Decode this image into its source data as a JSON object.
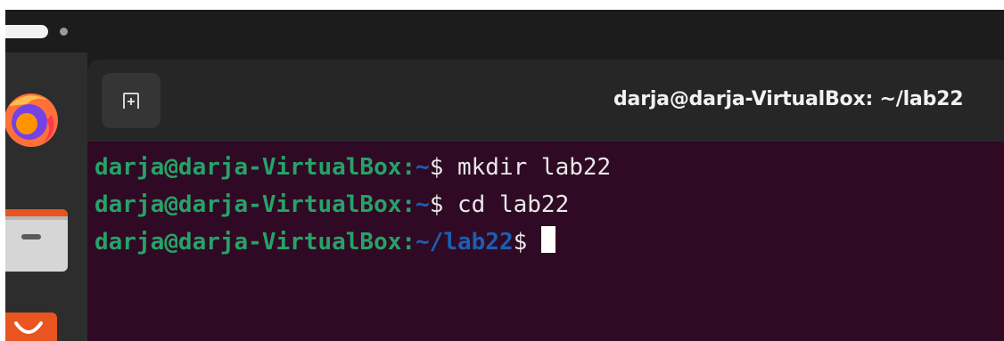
{
  "topbar": {
    "workspace_indicator": "active-workspace-pill"
  },
  "dock": {
    "apps": [
      {
        "name": "Firefox",
        "icon": "firefox-icon"
      },
      {
        "name": "Files",
        "icon": "files-icon"
      },
      {
        "name": "Ubuntu Software",
        "icon": "software-store-icon"
      }
    ]
  },
  "window": {
    "title": "darja@darja-VirtualBox: ~/lab22",
    "new_tab_icon": "new-tab-icon"
  },
  "terminal": {
    "lines": [
      {
        "user_host": "darja@darja-VirtualBox",
        "colon": ":",
        "path": "~",
        "dollar": "$",
        "command": " mkdir lab22"
      },
      {
        "user_host": "darja@darja-VirtualBox",
        "colon": ":",
        "path": "~",
        "dollar": "$",
        "command": " cd lab22"
      },
      {
        "user_host": "darja@darja-VirtualBox",
        "colon": ":",
        "path": "~/lab22",
        "dollar": "$",
        "command": " "
      }
    ]
  },
  "colors": {
    "terminal_bg": "#300a24",
    "prompt_user": "#26a269",
    "prompt_path": "#1a5fb4",
    "headerbar_bg": "#262626"
  }
}
